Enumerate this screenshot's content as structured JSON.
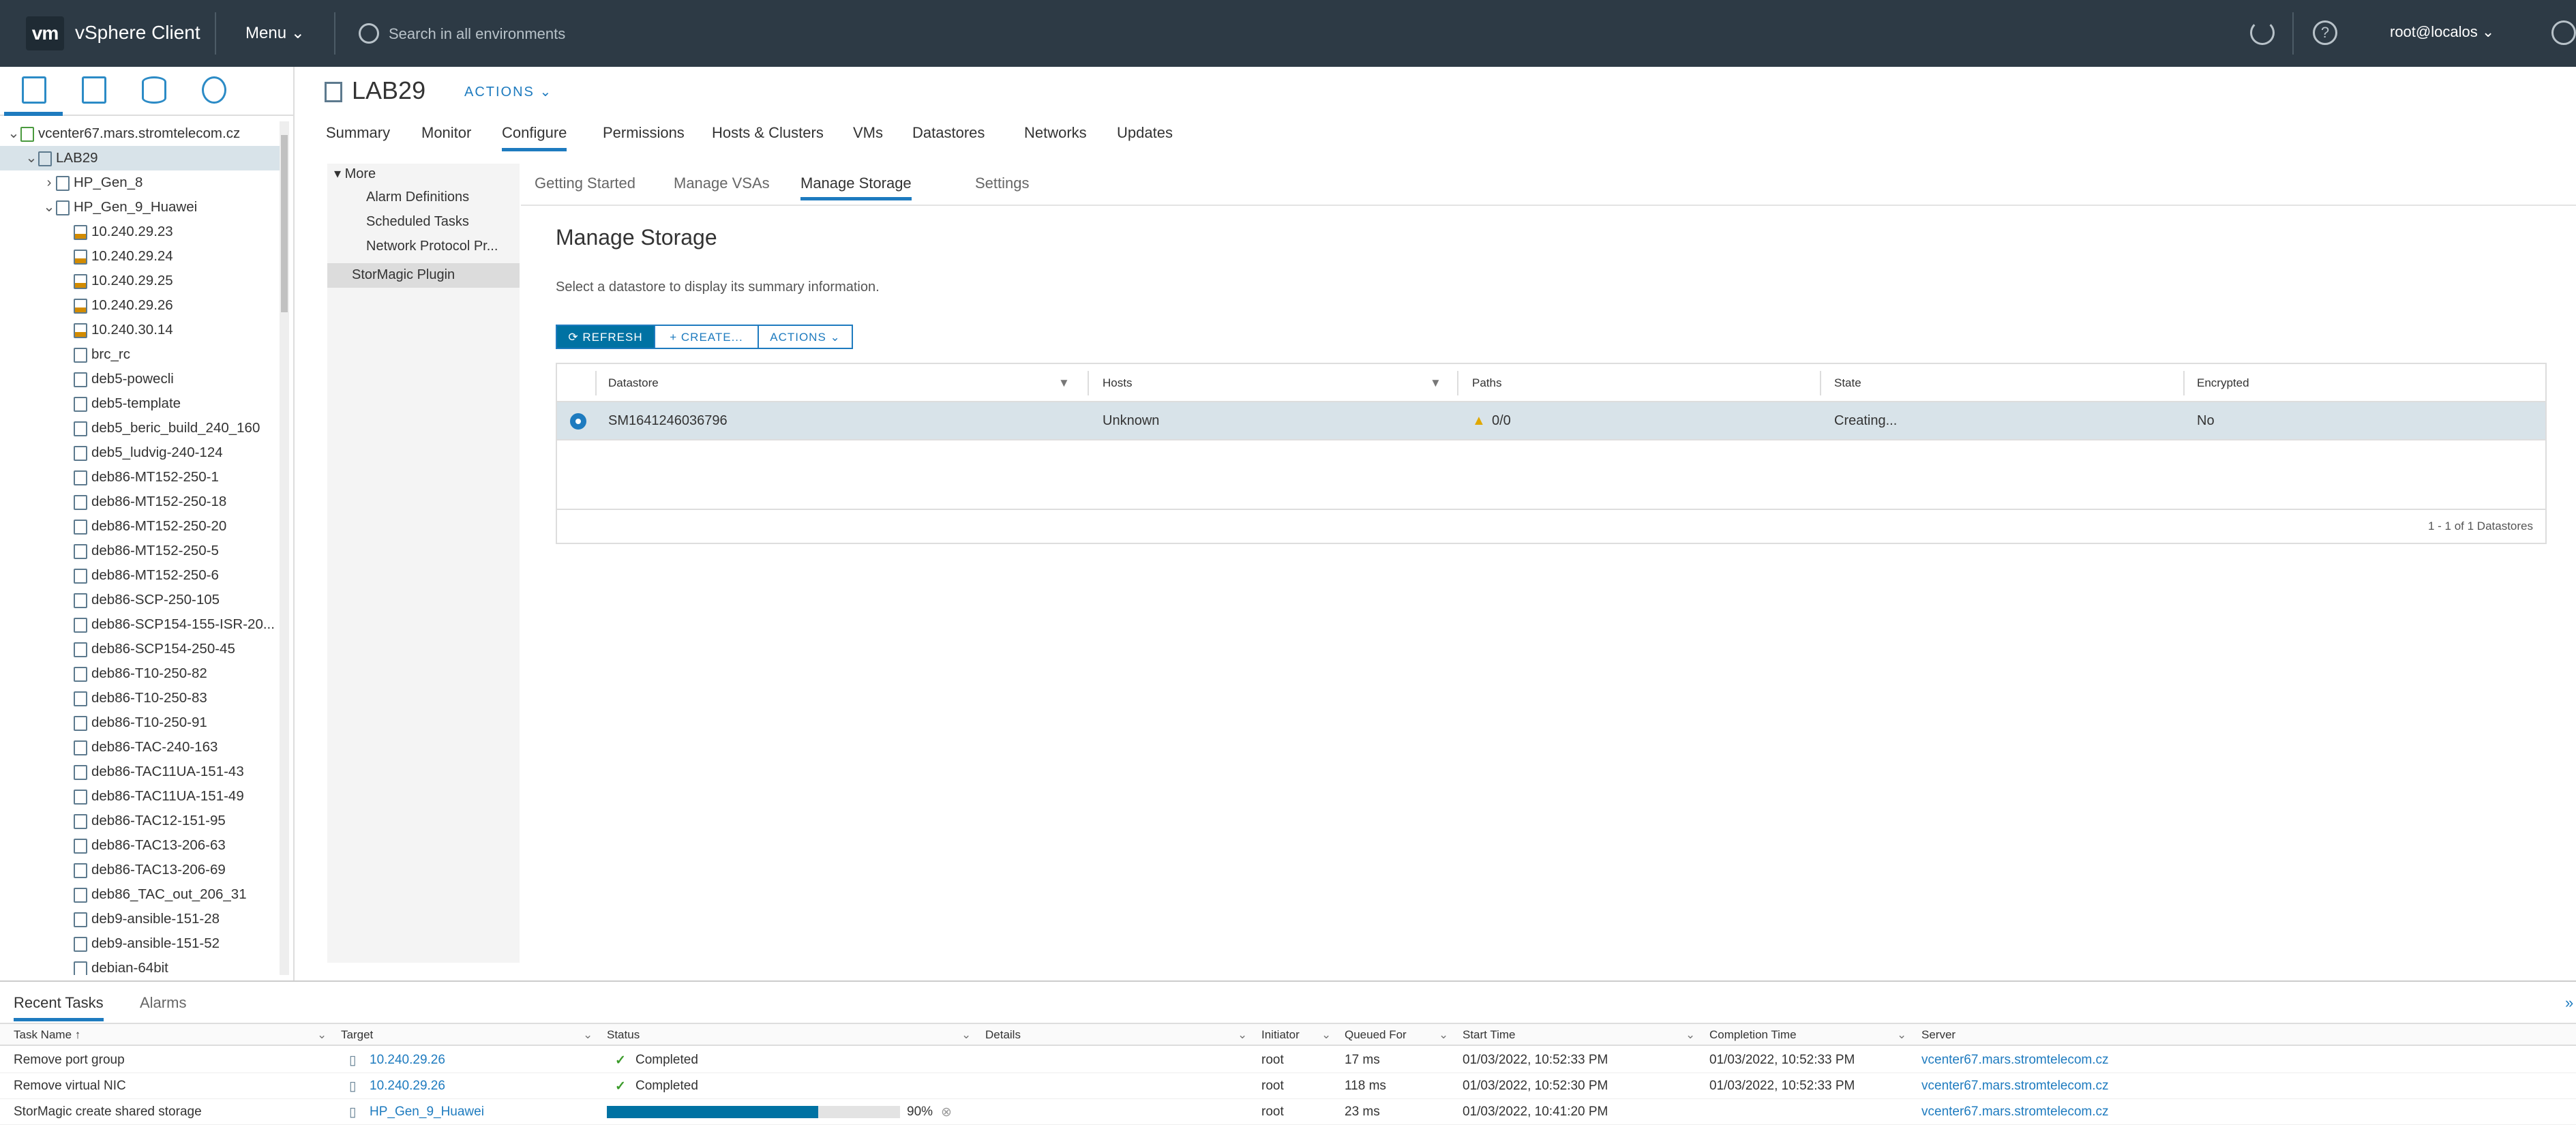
{
  "header": {
    "logo": "vm",
    "app_title": "vSphere Client",
    "menu_label": "Menu",
    "search_placeholder": "Search in all environments",
    "user": "root@localos",
    "help": "?"
  },
  "object": {
    "name": "LAB29",
    "actions": "ACTIONS"
  },
  "tabs": [
    "Summary",
    "Monitor",
    "Configure",
    "Permissions",
    "Hosts & Clusters",
    "VMs",
    "Datastores",
    "Networks",
    "Updates"
  ],
  "active_tab": "Configure",
  "left_panel": {
    "more": "More",
    "items": [
      "Alarm Definitions",
      "Scheduled Tasks",
      "Network Protocol Pr..."
    ],
    "selected": "StorMagic Plugin"
  },
  "sub_tabs": [
    "Getting Started",
    "Manage VSAs",
    "Manage Storage",
    "Settings"
  ],
  "active_sub_tab": "Manage Storage",
  "page_title": "Manage Storage",
  "hint": "Select a datastore to display its summary information.",
  "buttons": {
    "refresh": "REFRESH",
    "create": "+ CREATE...",
    "actions": "ACTIONS"
  },
  "grid": {
    "columns": [
      "Datastore",
      "Hosts",
      "Paths",
      "State",
      "Encrypted"
    ],
    "rows": [
      {
        "datastore": "SM1641246036796",
        "hosts": "Unknown",
        "paths": "0/0",
        "state": "Creating...",
        "encrypted": "No"
      }
    ],
    "footer": "1 - 1 of 1 Datastores"
  },
  "tree": [
    {
      "label": "vcenter67.mars.stromtelecom.cz",
      "type": "vc",
      "level": 0,
      "expanded": true
    },
    {
      "label": "LAB29",
      "type": "dc",
      "level": 1,
      "expanded": true,
      "selected": true
    },
    {
      "label": "HP_Gen_8",
      "type": "cluster",
      "level": 2,
      "expanded": false
    },
    {
      "label": "HP_Gen_9_Huawei",
      "type": "cluster",
      "level": 2,
      "expanded": true
    },
    {
      "label": "10.240.29.23",
      "type": "host",
      "level": 3
    },
    {
      "label": "10.240.29.24",
      "type": "host",
      "level": 3
    },
    {
      "label": "10.240.29.25",
      "type": "host",
      "level": 3
    },
    {
      "label": "10.240.29.26",
      "type": "host",
      "level": 3
    },
    {
      "label": "10.240.30.14",
      "type": "host",
      "level": 3
    },
    {
      "label": "brc_rc",
      "type": "vm",
      "level": 3
    },
    {
      "label": "deb5-powecli",
      "type": "vm",
      "level": 3
    },
    {
      "label": "deb5-template",
      "type": "vm",
      "level": 3
    },
    {
      "label": "deb5_beric_build_240_160",
      "type": "vm",
      "level": 3
    },
    {
      "label": "deb5_ludvig-240-124",
      "type": "vm",
      "level": 3
    },
    {
      "label": "deb86-MT152-250-1",
      "type": "vm",
      "level": 3
    },
    {
      "label": "deb86-MT152-250-18",
      "type": "vm",
      "level": 3
    },
    {
      "label": "deb86-MT152-250-20",
      "type": "vm",
      "level": 3
    },
    {
      "label": "deb86-MT152-250-5",
      "type": "vm",
      "level": 3
    },
    {
      "label": "deb86-MT152-250-6",
      "type": "vm",
      "level": 3
    },
    {
      "label": "deb86-SCP-250-105",
      "type": "vm",
      "level": 3
    },
    {
      "label": "deb86-SCP154-155-ISR-20...",
      "type": "vm",
      "level": 3
    },
    {
      "label": "deb86-SCP154-250-45",
      "type": "vm",
      "level": 3
    },
    {
      "label": "deb86-T10-250-82",
      "type": "vm",
      "level": 3
    },
    {
      "label": "deb86-T10-250-83",
      "type": "vm",
      "level": 3
    },
    {
      "label": "deb86-T10-250-91",
      "type": "vm",
      "level": 3
    },
    {
      "label": "deb86-TAC-240-163",
      "type": "vm",
      "level": 3
    },
    {
      "label": "deb86-TAC11UA-151-43",
      "type": "vm",
      "level": 3
    },
    {
      "label": "deb86-TAC11UA-151-49",
      "type": "vm",
      "level": 3
    },
    {
      "label": "deb86-TAC12-151-95",
      "type": "vm",
      "level": 3
    },
    {
      "label": "deb86-TAC13-206-63",
      "type": "vm",
      "level": 3
    },
    {
      "label": "deb86-TAC13-206-69",
      "type": "vm",
      "level": 3
    },
    {
      "label": "deb86_TAC_out_206_31",
      "type": "vm",
      "level": 3
    },
    {
      "label": "deb9-ansible-151-28",
      "type": "vm",
      "level": 3
    },
    {
      "label": "deb9-ansible-151-52",
      "type": "vm",
      "level": 3
    },
    {
      "label": "debian-64bit",
      "type": "vm",
      "level": 3
    }
  ],
  "bottom": {
    "tabs": [
      "Recent Tasks",
      "Alarms"
    ],
    "columns": [
      "Task Name ↑",
      "Target",
      "Status",
      "Details",
      "Initiator",
      "Queued For",
      "Start Time",
      "Completion Time",
      "Server"
    ],
    "tasks": [
      {
        "name": "Remove port group",
        "target": "10.240.29.26",
        "status": "Completed",
        "details": "",
        "initiator": "root",
        "queued": "17 ms",
        "start": "01/03/2022, 10:52:33 PM",
        "completion": "01/03/2022, 10:52:33 PM",
        "server": "vcenter67.mars.stromtelecom.cz"
      },
      {
        "name": "Remove virtual NIC",
        "target": "10.240.29.26",
        "status": "Completed",
        "details": "",
        "initiator": "root",
        "queued": "118 ms",
        "start": "01/03/2022, 10:52:30 PM",
        "completion": "01/03/2022, 10:52:33 PM",
        "server": "vcenter67.mars.stromtelecom.cz"
      },
      {
        "name": "StorMagic create shared storage",
        "target": "HP_Gen_9_Huawei",
        "status": "90%",
        "progress": 0.9,
        "details": "",
        "initiator": "root",
        "queued": "23 ms",
        "start": "01/03/2022, 10:41:20 PM",
        "completion": "",
        "server": "vcenter67.mars.stromtelecom.cz"
      }
    ]
  },
  "colors": {
    "header_bg": "#2d3a45",
    "accent": "#1e7bbf",
    "selected_row": "#d8e3e9",
    "ok": "#3b9b2a",
    "warning": "#e0a800"
  }
}
